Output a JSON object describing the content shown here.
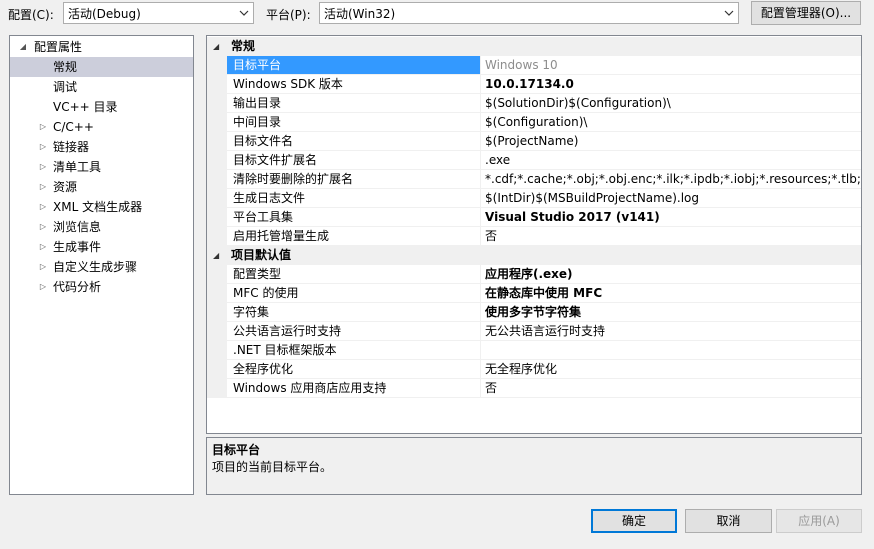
{
  "toolbar": {
    "config_label": "配置(C):",
    "config_value": "活动(Debug)",
    "platform_label": "平台(P):",
    "platform_value": "活动(Win32)",
    "config_manager_label": "配置管理器(O)..."
  },
  "tree": {
    "items": [
      {
        "label": "配置属性",
        "toggle": "◢",
        "level": 0,
        "selected": false
      },
      {
        "label": "常规",
        "toggle": "",
        "level": 1,
        "selected": true
      },
      {
        "label": "调试",
        "toggle": "",
        "level": 1,
        "selected": false
      },
      {
        "label": "VC++ 目录",
        "toggle": "",
        "level": 1,
        "selected": false
      },
      {
        "label": "C/C++",
        "toggle": "▷",
        "level": 1,
        "selected": false
      },
      {
        "label": "链接器",
        "toggle": "▷",
        "level": 1,
        "selected": false
      },
      {
        "label": "清单工具",
        "toggle": "▷",
        "level": 1,
        "selected": false
      },
      {
        "label": "资源",
        "toggle": "▷",
        "level": 1,
        "selected": false
      },
      {
        "label": "XML 文档生成器",
        "toggle": "▷",
        "level": 1,
        "selected": false
      },
      {
        "label": "浏览信息",
        "toggle": "▷",
        "level": 1,
        "selected": false
      },
      {
        "label": "生成事件",
        "toggle": "▷",
        "level": 1,
        "selected": false
      },
      {
        "label": "自定义生成步骤",
        "toggle": "▷",
        "level": 1,
        "selected": false
      },
      {
        "label": "代码分析",
        "toggle": "▷",
        "level": 1,
        "selected": false
      }
    ]
  },
  "grid": {
    "sections": [
      {
        "title": "常规",
        "toggle": "◢",
        "rows": [
          {
            "name": "目标平台",
            "value": "Windows 10",
            "style": "grey",
            "selected": true
          },
          {
            "name": "Windows SDK 版本",
            "value": "10.0.17134.0",
            "style": "bold",
            "selected": false
          },
          {
            "name": "输出目录",
            "value": "$(SolutionDir)$(Configuration)\\",
            "style": "",
            "selected": false
          },
          {
            "name": "中间目录",
            "value": "$(Configuration)\\",
            "style": "",
            "selected": false
          },
          {
            "name": "目标文件名",
            "value": "$(ProjectName)",
            "style": "",
            "selected": false
          },
          {
            "name": "目标文件扩展名",
            "value": ".exe",
            "style": "",
            "selected": false
          },
          {
            "name": "清除时要删除的扩展名",
            "value": "*.cdf;*.cache;*.obj;*.obj.enc;*.ilk;*.ipdb;*.iobj;*.resources;*.tlb;*.tli;*.t",
            "style": "",
            "selected": false
          },
          {
            "name": "生成日志文件",
            "value": "$(IntDir)$(MSBuildProjectName).log",
            "style": "",
            "selected": false
          },
          {
            "name": "平台工具集",
            "value": "Visual Studio 2017 (v141)",
            "style": "bold",
            "selected": false
          },
          {
            "name": "启用托管增量生成",
            "value": "否",
            "style": "",
            "selected": false
          }
        ]
      },
      {
        "title": "项目默认值",
        "toggle": "◢",
        "rows": [
          {
            "name": "配置类型",
            "value": "应用程序(.exe)",
            "style": "bold",
            "selected": false
          },
          {
            "name": "MFC 的使用",
            "value": "在静态库中使用 MFC",
            "style": "bold",
            "selected": false
          },
          {
            "name": "字符集",
            "value": "使用多字节字符集",
            "style": "bold",
            "selected": false
          },
          {
            "name": "公共语言运行时支持",
            "value": "无公共语言运行时支持",
            "style": "",
            "selected": false
          },
          {
            "name": ".NET 目标框架版本",
            "value": "",
            "style": "",
            "selected": false
          },
          {
            "name": "全程序优化",
            "value": "无全程序优化",
            "style": "",
            "selected": false
          },
          {
            "name": "Windows 应用商店应用支持",
            "value": "否",
            "style": "",
            "selected": false
          }
        ]
      }
    ]
  },
  "description": {
    "title": "目标平台",
    "text": "项目的当前目标平台。"
  },
  "buttons": {
    "ok": "确定",
    "cancel": "取消",
    "apply": "应用(A)"
  },
  "colors": {
    "selection": "#3399ff",
    "tree_selection": "#cccedb",
    "default_button_border": "#0078d7"
  }
}
